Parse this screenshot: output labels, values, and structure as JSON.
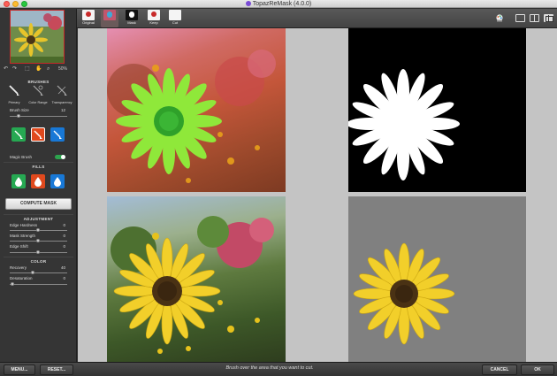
{
  "window": {
    "title": "TopazReMask (4.0.0)"
  },
  "toolbar": {
    "views": [
      {
        "label": "Original"
      },
      {
        "label": ""
      },
      {
        "label": "Mask"
      },
      {
        "label": "Keep"
      },
      {
        "label": "Cut"
      }
    ],
    "icons": [
      "paint-icon",
      "single-view-icon",
      "split-view-icon",
      "quad-view-icon"
    ]
  },
  "sidebar": {
    "navigator": {
      "zoom": "50%"
    },
    "brushes": {
      "title": "BRUSHES",
      "tools": [
        {
          "label": "Primary"
        },
        {
          "label": "Color Range"
        },
        {
          "label": "Transparency"
        }
      ],
      "brush_size": {
        "label": "Brush Size",
        "value": "12"
      },
      "colors": [
        "#26a852",
        "#e0491d",
        "#1878d6"
      ],
      "magic_brush": {
        "label": "Magic Brush",
        "on": true
      }
    },
    "fills": {
      "title": "FILLS"
    },
    "compute_label": "COMPUTE MASK",
    "adjustment": {
      "title": "ADJUSTMENT",
      "edge_hardness": {
        "label": "Edge Hardness",
        "value": "0"
      },
      "mask_strength": {
        "label": "Mask Strength",
        "value": "0"
      },
      "edge_shift": {
        "label": "Edge Shift",
        "value": "0"
      }
    },
    "color": {
      "title": "COLOR",
      "recovery": {
        "label": "Recovery",
        "value": "40"
      },
      "desaturation": {
        "label": "Desaturation",
        "value": "0"
      }
    }
  },
  "bottom": {
    "menu_label": "MENU...",
    "reset_label": "RESET...",
    "status": "Brush over the area that you want to cut.",
    "cancel_label": "CANCEL",
    "ok_label": "OK"
  }
}
